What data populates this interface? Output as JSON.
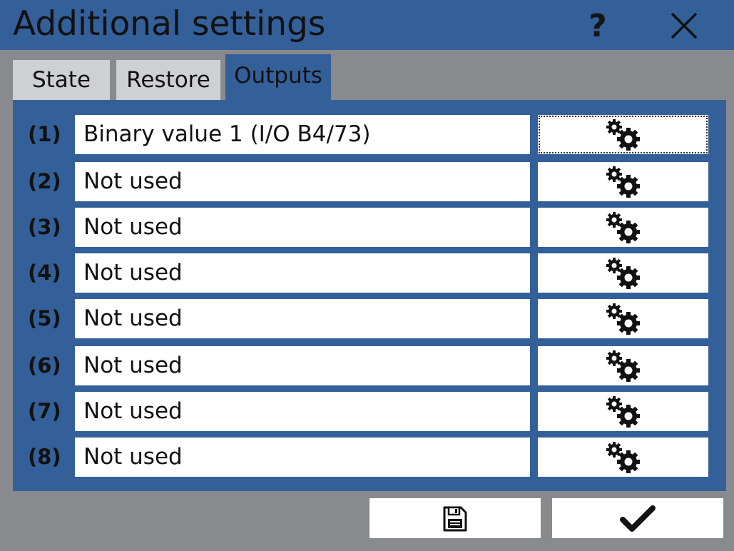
{
  "window": {
    "title": "Additional settings",
    "help_label": "?",
    "close_icon": "close-icon"
  },
  "colors": {
    "accent": "#34609a",
    "background": "#898a8d",
    "tab_inactive": "#cfd0d2",
    "field": "#ffffff"
  },
  "tabs": [
    {
      "label": "State",
      "active": false
    },
    {
      "label": "Restore",
      "active": false
    },
    {
      "label": "Outputs",
      "active": true
    }
  ],
  "outputs": [
    {
      "number": "(1)",
      "value": "Binary value 1 (I/O B4/73)",
      "settings_icon": "gears-icon"
    },
    {
      "number": "(2)",
      "value": "Not used",
      "settings_icon": "gears-icon"
    },
    {
      "number": "(3)",
      "value": "Not used",
      "settings_icon": "gears-icon"
    },
    {
      "number": "(4)",
      "value": "Not used",
      "settings_icon": "gears-icon"
    },
    {
      "number": "(5)",
      "value": "Not used",
      "settings_icon": "gears-icon"
    },
    {
      "number": "(6)",
      "value": "Not used",
      "settings_icon": "gears-icon"
    },
    {
      "number": "(7)",
      "value": "Not used",
      "settings_icon": "gears-icon"
    },
    {
      "number": "(8)",
      "value": "Not used",
      "settings_icon": "gears-icon"
    }
  ],
  "footer": {
    "save_icon": "save-icon",
    "confirm_icon": "checkmark-icon"
  }
}
